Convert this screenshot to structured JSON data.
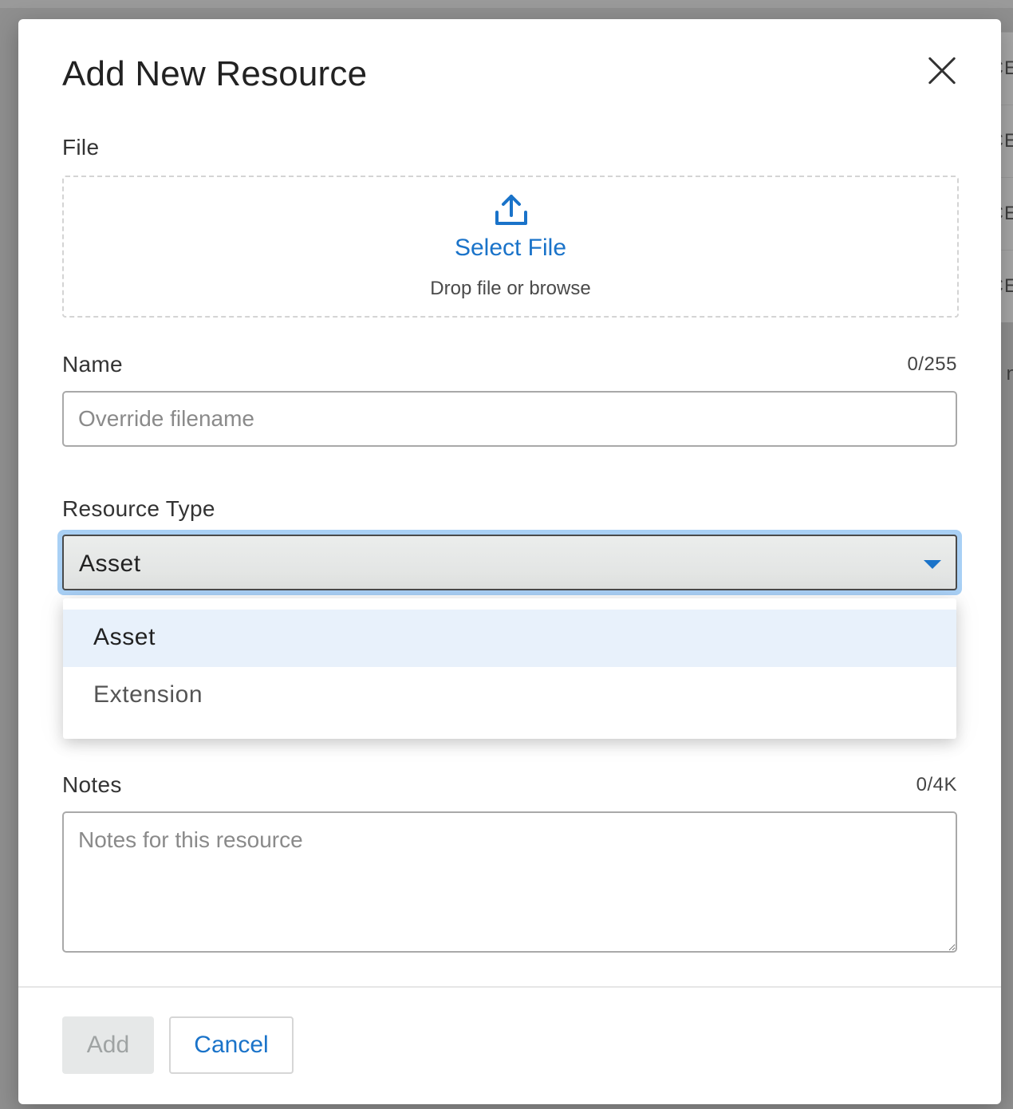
{
  "background": {
    "fragments": [
      "CE",
      "CE",
      "CE",
      "CE",
      "n"
    ]
  },
  "modal": {
    "title": "Add New Resource",
    "close_icon": "close-icon"
  },
  "file": {
    "label": "File",
    "upload_icon": "upload-icon",
    "select_label": "Select File",
    "hint": "Drop file or browse"
  },
  "name": {
    "label": "Name",
    "counter": "0/255",
    "value": "",
    "placeholder": "Override filename"
  },
  "resource_type": {
    "label": "Resource Type",
    "selected": "Asset",
    "options": [
      "Asset",
      "Extension"
    ]
  },
  "notes": {
    "label": "Notes",
    "counter": "0/4K",
    "value": "",
    "placeholder": "Notes for this resource"
  },
  "footer": {
    "add_label": "Add",
    "cancel_label": "Cancel"
  },
  "colors": {
    "accent": "#1a73c9",
    "focus_ring": "#a9d0f5",
    "selected_option_bg": "#e8f1fb"
  }
}
